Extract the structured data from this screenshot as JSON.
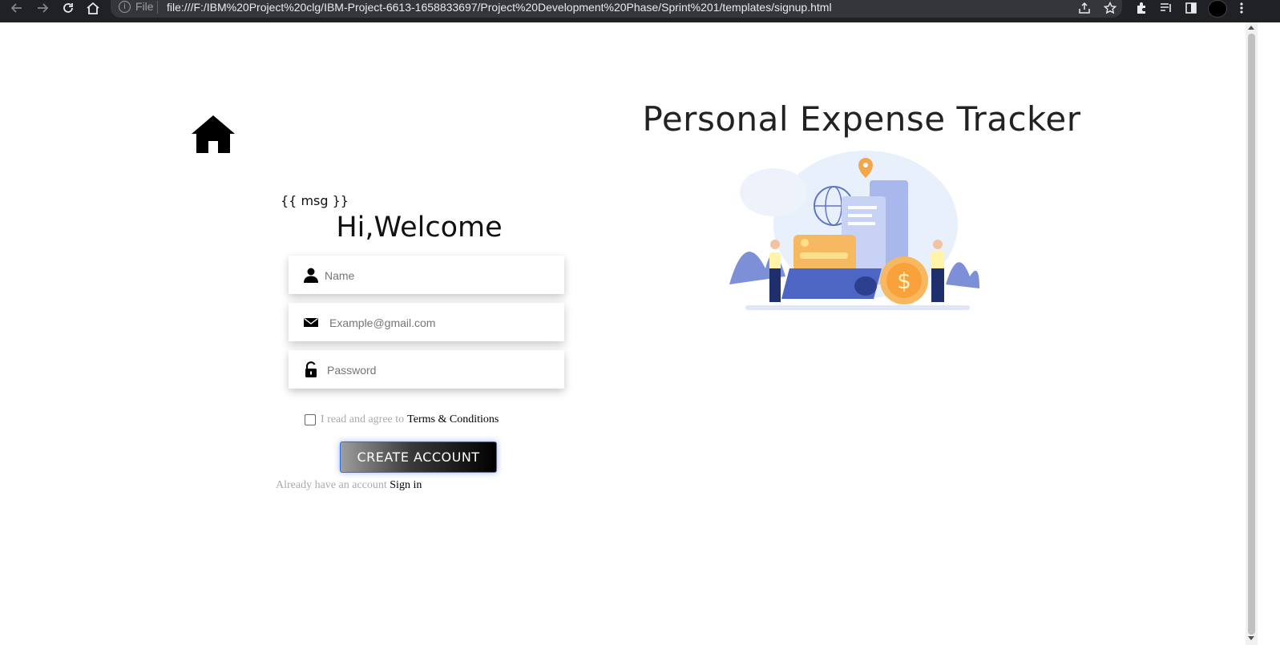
{
  "browser": {
    "site_label": "File",
    "url": "file:///F:/IBM%20Project%20clg/IBM-Project-6613-1658833697/Project%20Development%20Phase/Sprint%201/templates/signup.html"
  },
  "page": {
    "msg": "{{ msg }}",
    "welcome": "Hi,Welcome",
    "name_placeholder": "Name",
    "email_placeholder": "Example@gmail.com",
    "password_placeholder": "Password",
    "terms_text": "I read and agree to",
    "terms_link": "Terms & Conditions",
    "create_button": "CREATE ACCOUNT",
    "signin_text": "Already have an account",
    "signin_link": "Sign in",
    "title": "Personal Expense Tracker"
  },
  "icons": [
    "back-icon",
    "forward-icon",
    "reload-icon",
    "home-icon",
    "info-icon",
    "share-icon",
    "star-icon",
    "extensions-icon",
    "reading-list-icon",
    "side-panel-icon",
    "menu-icon",
    "user-icon",
    "envelope-icon",
    "lock-icon"
  ],
  "colors": {
    "chrome_bg": "#202124",
    "omnibox_bg": "#35363a",
    "button_border": "#2b6fd6"
  }
}
